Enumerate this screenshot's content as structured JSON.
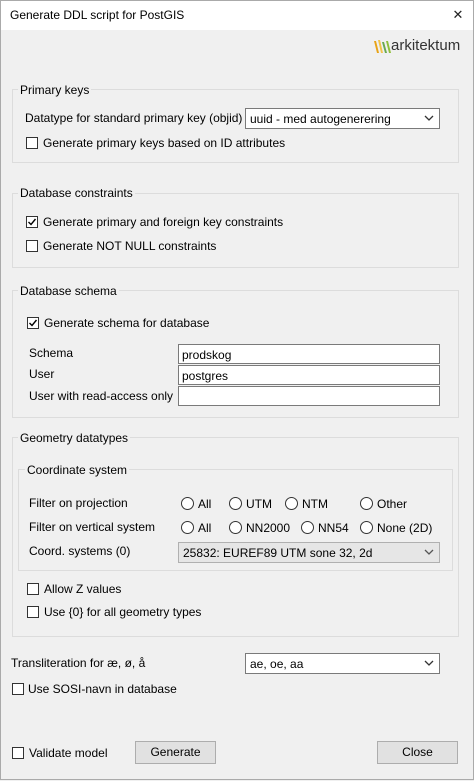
{
  "window": {
    "title": "Generate DDL script for PostGIS"
  },
  "logo": {
    "text": "arkitektum"
  },
  "primary_keys": {
    "legend": "Primary keys",
    "datatype_label": "Datatype for standard primary key (objid)",
    "datatype_value": "uuid - med autogenerering",
    "gen_id_attr_label": "Generate primary keys based on ID attributes",
    "gen_id_attr_checked": false
  },
  "db_constraints": {
    "legend": "Database constraints",
    "pk_fk_label": "Generate primary and foreign key constraints",
    "pk_fk_checked": true,
    "not_null_label": "Generate NOT NULL constraints",
    "not_null_checked": false
  },
  "db_schema": {
    "legend": "Database schema",
    "gen_schema_label": "Generate schema for database",
    "gen_schema_checked": true,
    "schema_label": "Schema",
    "schema_value": "prodskog",
    "user_label": "User",
    "user_value": "postgres",
    "readonly_user_label": "User with read-access only",
    "readonly_user_value": ""
  },
  "geometry": {
    "legend": "Geometry datatypes",
    "coord_system": {
      "legend": "Coordinate system",
      "filter_projection_label": "Filter on projection",
      "projection_options": [
        "All",
        "UTM",
        "NTM",
        "Other"
      ],
      "filter_vertical_label": "Filter on vertical system",
      "vertical_options": [
        "All",
        "NN2000",
        "NN54",
        "None (2D)"
      ],
      "coord_systems_label": "Coord. systems (0)",
      "coord_systems_value": "25832: EUREF89 UTM sone 32, 2d"
    },
    "allow_z_label": "Allow Z values",
    "allow_z_checked": false,
    "use_all_geom_label": "Use {0} for all geometry types",
    "use_all_geom_checked": false
  },
  "transliteration": {
    "label": "Transliteration for æ, ø, å",
    "value": "ae, oe, aa"
  },
  "sosi": {
    "label": "Use SOSI-navn in database",
    "checked": false
  },
  "footer": {
    "validate_label": "Validate model",
    "validate_checked": false,
    "generate_label": "Generate",
    "close_label": "Close"
  }
}
